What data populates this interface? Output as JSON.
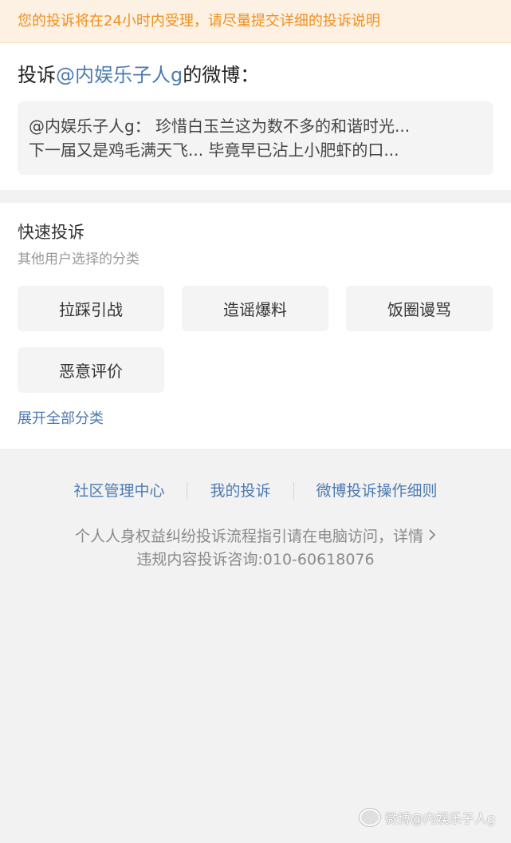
{
  "notice": "您的投诉将在24小时内受理，请尽量提交详细的投诉说明",
  "target": {
    "prefix": "投诉",
    "mention": "@内娱乐子人g",
    "suffix": "的微博："
  },
  "quote": {
    "line1": "@内娱乐子人g： 珍惜白玉兰这为数不多的和谐时光...",
    "line2": "下一届又是鸡毛满天飞... 毕竟早已沾上小肥虾的口..."
  },
  "quick": {
    "title": "快速投诉",
    "subtitle": "其他用户选择的分类",
    "tags": [
      "拉踩引战",
      "造谣爆料",
      "饭圈谩骂",
      "恶意评价"
    ],
    "expand": "展开全部分类"
  },
  "footer": {
    "links": [
      "社区管理中心",
      "我的投诉",
      "微博投诉操作细则"
    ],
    "guide": "个人人身权益纠纷投诉流程指引请在电脑访问，详情",
    "guide_icon": "chevron-right-icon",
    "hotline": "违规内容投诉咨询:010-60618076"
  },
  "watermark": {
    "icon": "weibo-logo-icon",
    "text": "微博@内娱乐子人g"
  }
}
